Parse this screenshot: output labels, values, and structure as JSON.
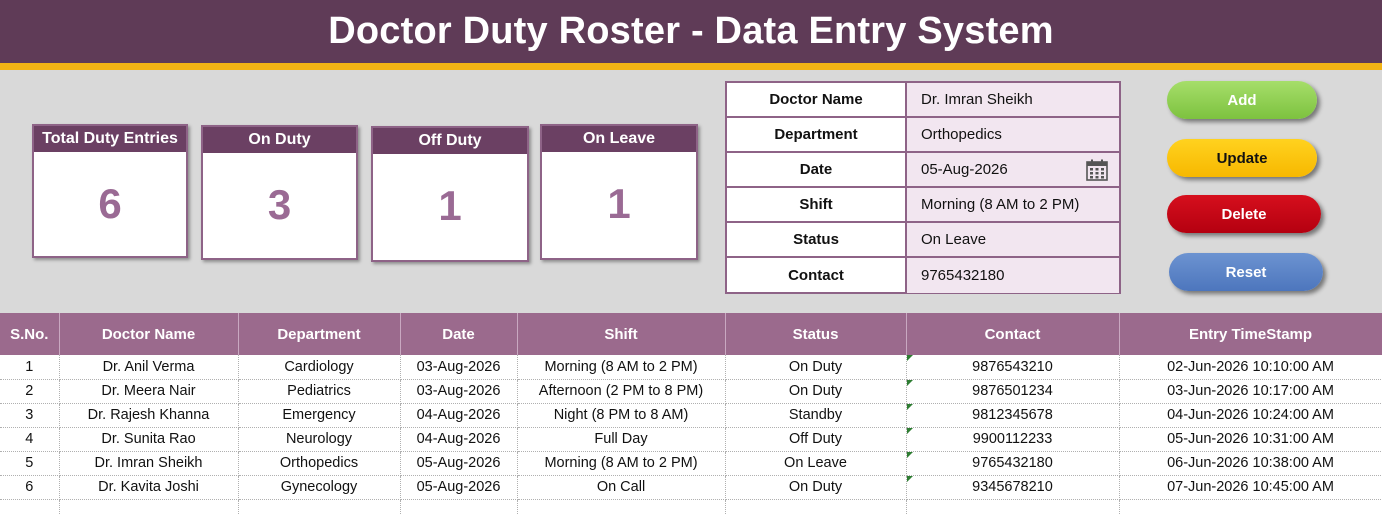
{
  "header": {
    "title": "Doctor Duty Roster - Data Entry System"
  },
  "cards": [
    {
      "title": "Total Duty Entries",
      "value": "6"
    },
    {
      "title": "On Duty",
      "value": "3"
    },
    {
      "title": "Off Duty",
      "value": "1"
    },
    {
      "title": "On Leave",
      "value": "1"
    }
  ],
  "form": {
    "rows": [
      {
        "label": "Doctor Name",
        "value": "Dr. Imran Sheikh"
      },
      {
        "label": "Department",
        "value": "Orthopedics"
      },
      {
        "label": "Date",
        "value": "05-Aug-2026"
      },
      {
        "label": "Shift",
        "value": "Morning (8 AM to 2 PM)"
      },
      {
        "label": "Status",
        "value": "On Leave"
      },
      {
        "label": "Contact",
        "value": "9765432180"
      }
    ]
  },
  "buttons": {
    "add": "Add",
    "update": "Update",
    "delete": "Delete",
    "reset": "Reset"
  },
  "table": {
    "columns": [
      "S.No.",
      "Doctor Name",
      "Department",
      "Date",
      "Shift",
      "Status",
      "Contact",
      "Entry TimeStamp"
    ],
    "rows": [
      [
        "1",
        "Dr. Anil Verma",
        "Cardiology",
        "03-Aug-2026",
        "Morning (8 AM to 2 PM)",
        "On Duty",
        "9876543210",
        "02-Jun-2026 10:10:00 AM"
      ],
      [
        "2",
        "Dr. Meera Nair",
        "Pediatrics",
        "03-Aug-2026",
        "Afternoon (2 PM to 8 PM)",
        "On Duty",
        "9876501234",
        "03-Jun-2026 10:17:00 AM"
      ],
      [
        "3",
        "Dr. Rajesh Khanna",
        "Emergency",
        "04-Aug-2026",
        "Night (8 PM to 8 AM)",
        "Standby",
        "9812345678",
        "04-Jun-2026 10:24:00 AM"
      ],
      [
        "4",
        "Dr. Sunita Rao",
        "Neurology",
        "04-Aug-2026",
        "Full Day",
        "Off Duty",
        "9900112233",
        "05-Jun-2026 10:31:00 AM"
      ],
      [
        "5",
        "Dr. Imran Sheikh",
        "Orthopedics",
        "05-Aug-2026",
        "Morning (8 AM to 2 PM)",
        "On Leave",
        "9765432180",
        "06-Jun-2026 10:38:00 AM"
      ],
      [
        "6",
        "Dr. Kavita Joshi",
        "Gynecology",
        "05-Aug-2026",
        "On Call",
        "On Duty",
        "9345678210",
        "07-Jun-2026 10:45:00 AM"
      ]
    ]
  },
  "colors": {
    "header": "#5f3b57",
    "accent": "#f2b315",
    "table_header": "#9b6a8d",
    "card_value": "#9a6a94"
  },
  "icons": {
    "date_picker": "calendar-icon"
  }
}
